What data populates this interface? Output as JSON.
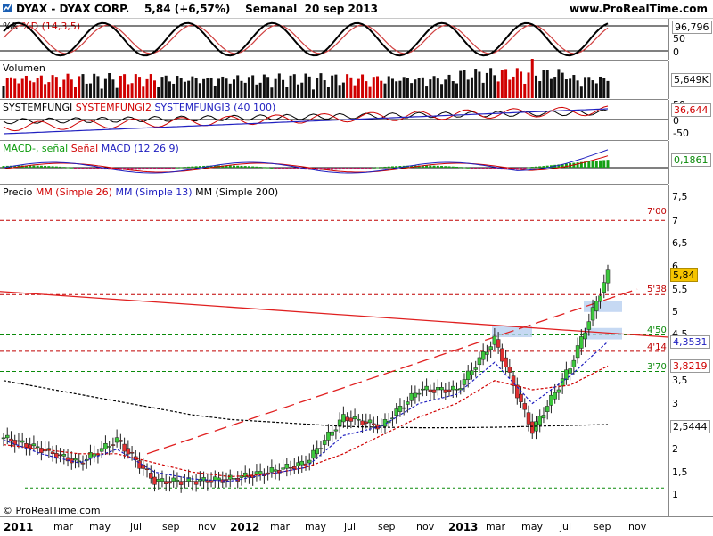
{
  "header": {
    "title": "DYAX - DYAX CORP.    5,84 (+6,57%)    Semanal  20 sep 2013",
    "site": "www.ProRealTime.com"
  },
  "footer": {
    "copyright": "© ProRealTime.com"
  },
  "colors": {
    "red": "#d00000",
    "blue": "#2020c0",
    "green": "#14a014",
    "up_candle": "#3cc83c",
    "down_candle": "#e03030"
  },
  "panels": {
    "stoch": {
      "label_k": "%K",
      "label_d": "%D (14,3,5)",
      "ticks": [
        "96,796",
        "50",
        "0"
      ]
    },
    "volume": {
      "label": "Volumen",
      "value": "5,649K"
    },
    "systemfungi": {
      "label1": "SYSTEMFUNGI",
      "label2": "SYSTEMFUNGI2",
      "label3": "SYSTEMFUNGI3 (40 100)",
      "ticks": [
        "50",
        "36,644",
        "0",
        "-50"
      ]
    },
    "macd": {
      "label1": "MACD-, señal",
      "label2": "Señal",
      "label3": "MACD (12 26 9)",
      "value": "0,1861"
    },
    "price": {
      "label_prefix": "Precio",
      "mm26": "MM (Simple 26)",
      "mm13": "MM (Simple 13)",
      "mm200": "MM (Simple 200)",
      "ticks": [
        "7,5",
        "7",
        "6,5",
        "6",
        "5,5",
        "5",
        "4,5",
        "3,5",
        "3",
        "2",
        "1,5",
        "1"
      ],
      "tag_last": "5,84",
      "tag_mm13": "4,3531",
      "tag_mm26": "3,8219",
      "tag_mm200": "2,5444",
      "levels": [
        "7'00",
        "5'38",
        "4'50",
        "4'14",
        "3'70"
      ]
    }
  },
  "xaxis": [
    "2011",
    "mar",
    "may",
    "jul",
    "sep",
    "nov",
    "2012",
    "mar",
    "may",
    "jul",
    "sep",
    "nov",
    "2013",
    "mar",
    "may",
    "jul",
    "sep",
    "nov"
  ],
  "chart_data": {
    "type": "line",
    "title": "DYAX - DYAX CORP. Semanal 20 sep 2013",
    "last_close": 5.84,
    "change_pct": 6.57,
    "ylim": [
      1,
      7.5
    ],
    "horizontal_levels": [
      7.0,
      5.38,
      4.5,
      4.14,
      3.7
    ],
    "series": [
      {
        "name": "Precio",
        "x": [
          "2011-01",
          "2011-03",
          "2011-05",
          "2011-07",
          "2011-09",
          "2011-11",
          "2012-01",
          "2012-03",
          "2012-05",
          "2012-07",
          "2012-09",
          "2012-11",
          "2013-01",
          "2013-03",
          "2013-05",
          "2013-07",
          "2013-09"
        ],
        "y": [
          2.25,
          2.0,
          1.7,
          2.2,
          1.3,
          1.3,
          1.35,
          1.5,
          1.7,
          2.7,
          2.5,
          3.3,
          3.3,
          4.4,
          2.4,
          3.8,
          5.84
        ]
      },
      {
        "name": "MM (Simple 26)",
        "y": [
          2.1,
          2.0,
          1.9,
          1.9,
          1.7,
          1.5,
          1.4,
          1.45,
          1.6,
          1.9,
          2.3,
          2.7,
          3.0,
          3.5,
          3.3,
          3.4,
          3.82
        ]
      },
      {
        "name": "MM (Simple 13)",
        "y": [
          2.2,
          1.9,
          1.7,
          2.0,
          1.5,
          1.35,
          1.3,
          1.45,
          1.6,
          2.3,
          2.5,
          3.0,
          3.2,
          3.9,
          3.0,
          3.6,
          4.35
        ]
      },
      {
        "name": "MM (Simple 200)",
        "y": [
          3.5,
          3.35,
          3.2,
          3.05,
          2.9,
          2.75,
          2.65,
          2.6,
          2.55,
          2.5,
          2.48,
          2.47,
          2.47,
          2.48,
          2.5,
          2.52,
          2.54
        ]
      }
    ],
    "stochastic": {
      "k_last": 96.796
    },
    "volume_last": "5,649K",
    "systemfungi_last": 36.644,
    "macd_last": 0.1861
  }
}
